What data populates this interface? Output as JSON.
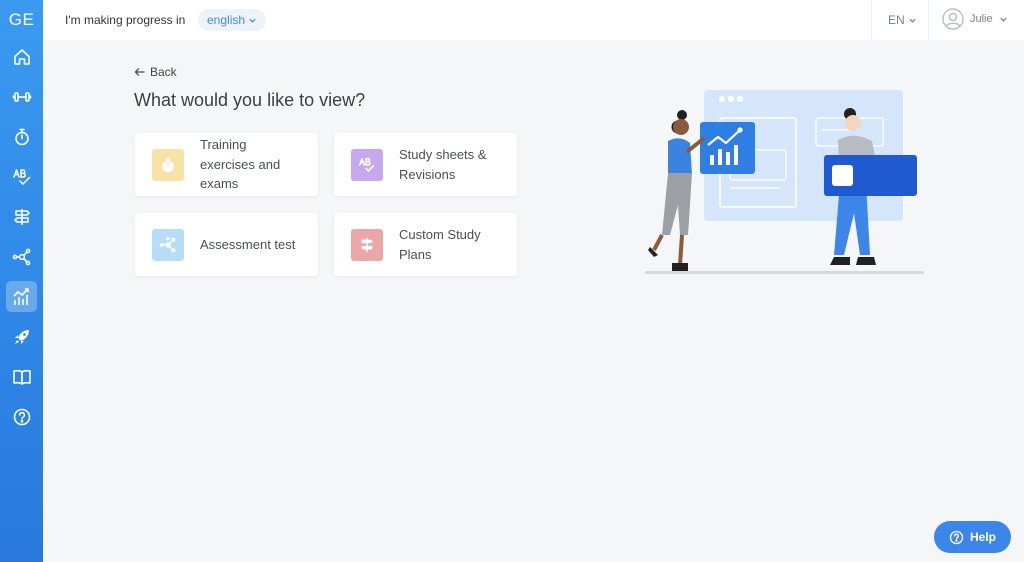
{
  "sidebar": {
    "brand": "GE",
    "items": [
      {
        "name": "home-icon",
        "active": false
      },
      {
        "name": "dumbbell-icon",
        "active": false
      },
      {
        "name": "stopwatch-icon",
        "active": false
      },
      {
        "name": "ab-check-icon",
        "active": false
      },
      {
        "name": "signpost-icon",
        "active": false
      },
      {
        "name": "network-icon",
        "active": false
      },
      {
        "name": "chart-icon",
        "active": true
      },
      {
        "name": "rocket-icon",
        "active": false
      },
      {
        "name": "book-icon",
        "active": false
      },
      {
        "name": "question-icon",
        "active": false
      }
    ]
  },
  "topbar": {
    "progress_label": "I'm making progress in",
    "language": "english",
    "locale": "EN",
    "user_name": "Julie"
  },
  "main": {
    "back_label": "Back",
    "title": "What would you like to view?",
    "cards": [
      {
        "label": "Training exercises and exams",
        "icon": "stopwatch-icon",
        "icon_bg": "#f8e2a6",
        "icon_color": "#ffffff"
      },
      {
        "label": "Study sheets & Revisions",
        "icon": "ab-check-icon",
        "icon_bg": "#c5a8ee",
        "icon_color": "#ffffff"
      },
      {
        "label": "Assessment test",
        "icon": "network-icon",
        "icon_bg": "#b6dcf8",
        "icon_color": "#ffffff"
      },
      {
        "label": "Custom Study Plans",
        "icon": "signpost-icon",
        "icon_bg": "#eba7a7",
        "icon_color": "#ffffff"
      }
    ]
  },
  "help": {
    "label": "Help"
  },
  "colors": {
    "primary": "#3a8ee8",
    "sidebar": "#2e86e6"
  }
}
